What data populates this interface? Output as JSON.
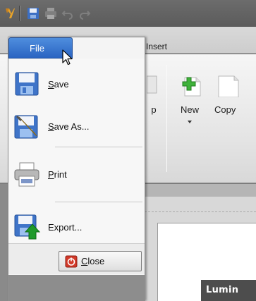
{
  "quick_access": {
    "icons": [
      "app-logo-icon",
      "save-icon",
      "print-icon",
      "undo-icon",
      "redo-icon"
    ]
  },
  "ribbon": {
    "tab_partial": "Insert",
    "buttons": [
      {
        "label": "p",
        "icon": "partial-icon"
      },
      {
        "label": "New",
        "icon": "new-page-icon"
      },
      {
        "label": "Copy",
        "icon": "copy-icon"
      }
    ]
  },
  "file_menu": {
    "tab_label": "File",
    "items": [
      {
        "label": "Save",
        "mnemonic": "S",
        "rest": "ave",
        "icon": "save-icon"
      },
      {
        "label": "Save As...",
        "mnemonic": "S",
        "rest": "ave As...",
        "icon": "save-as-icon"
      },
      {
        "label": "Print",
        "mnemonic": "P",
        "rest": "rint",
        "icon": "printer-icon"
      },
      {
        "label": "Export...",
        "mnemonic": "",
        "rest": "Export...",
        "icon": "export-icon"
      }
    ],
    "close_button": {
      "label": "Close",
      "mnemonic": "C",
      "rest": "lose",
      "icon": "close-icon"
    }
  },
  "document": {
    "title_partial": "Lumin"
  },
  "colors": {
    "file_tab": "#3a76d0",
    "export_arrow": "#1e9a2a",
    "close_icon": "#d23a2a"
  }
}
